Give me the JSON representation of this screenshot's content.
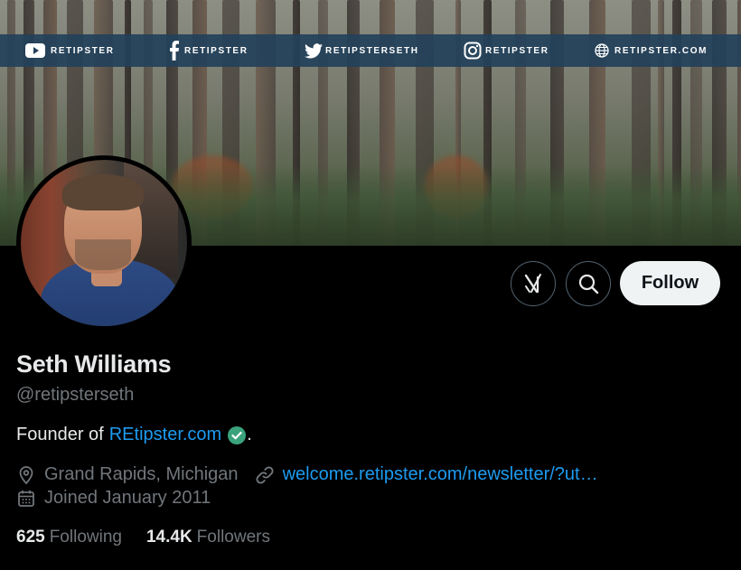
{
  "banner": {
    "social": [
      {
        "icon": "youtube-icon",
        "label": "RETIPSTER"
      },
      {
        "icon": "facebook-icon",
        "label": "RETIPSTER"
      },
      {
        "icon": "twitter-icon",
        "label": "RETIPSTERSETH"
      },
      {
        "icon": "instagram-icon",
        "label": "RETIPSTER"
      },
      {
        "icon": "globe-icon",
        "label": "RETIPSTER.COM"
      }
    ]
  },
  "actions": {
    "grok_icon": "grok-icon",
    "search_icon": "search-icon",
    "follow_label": "Follow"
  },
  "profile": {
    "name": "Seth Williams",
    "handle": "@retipsterseth",
    "bio_prefix": "Founder of",
    "bio_link": "REtipster.com",
    "bio_suffix": ".",
    "location": "Grand Rapids, Michigan",
    "website": "welcome.retipster.com/newsletter/?ut…",
    "joined": "Joined January 2011"
  },
  "stats": {
    "following_count": "625",
    "following_label": "Following",
    "followers_count": "14.4K",
    "followers_label": "Followers"
  },
  "colors": {
    "accent": "#1d9bf0",
    "muted": "#71767b",
    "verified": "#3aa37c"
  }
}
